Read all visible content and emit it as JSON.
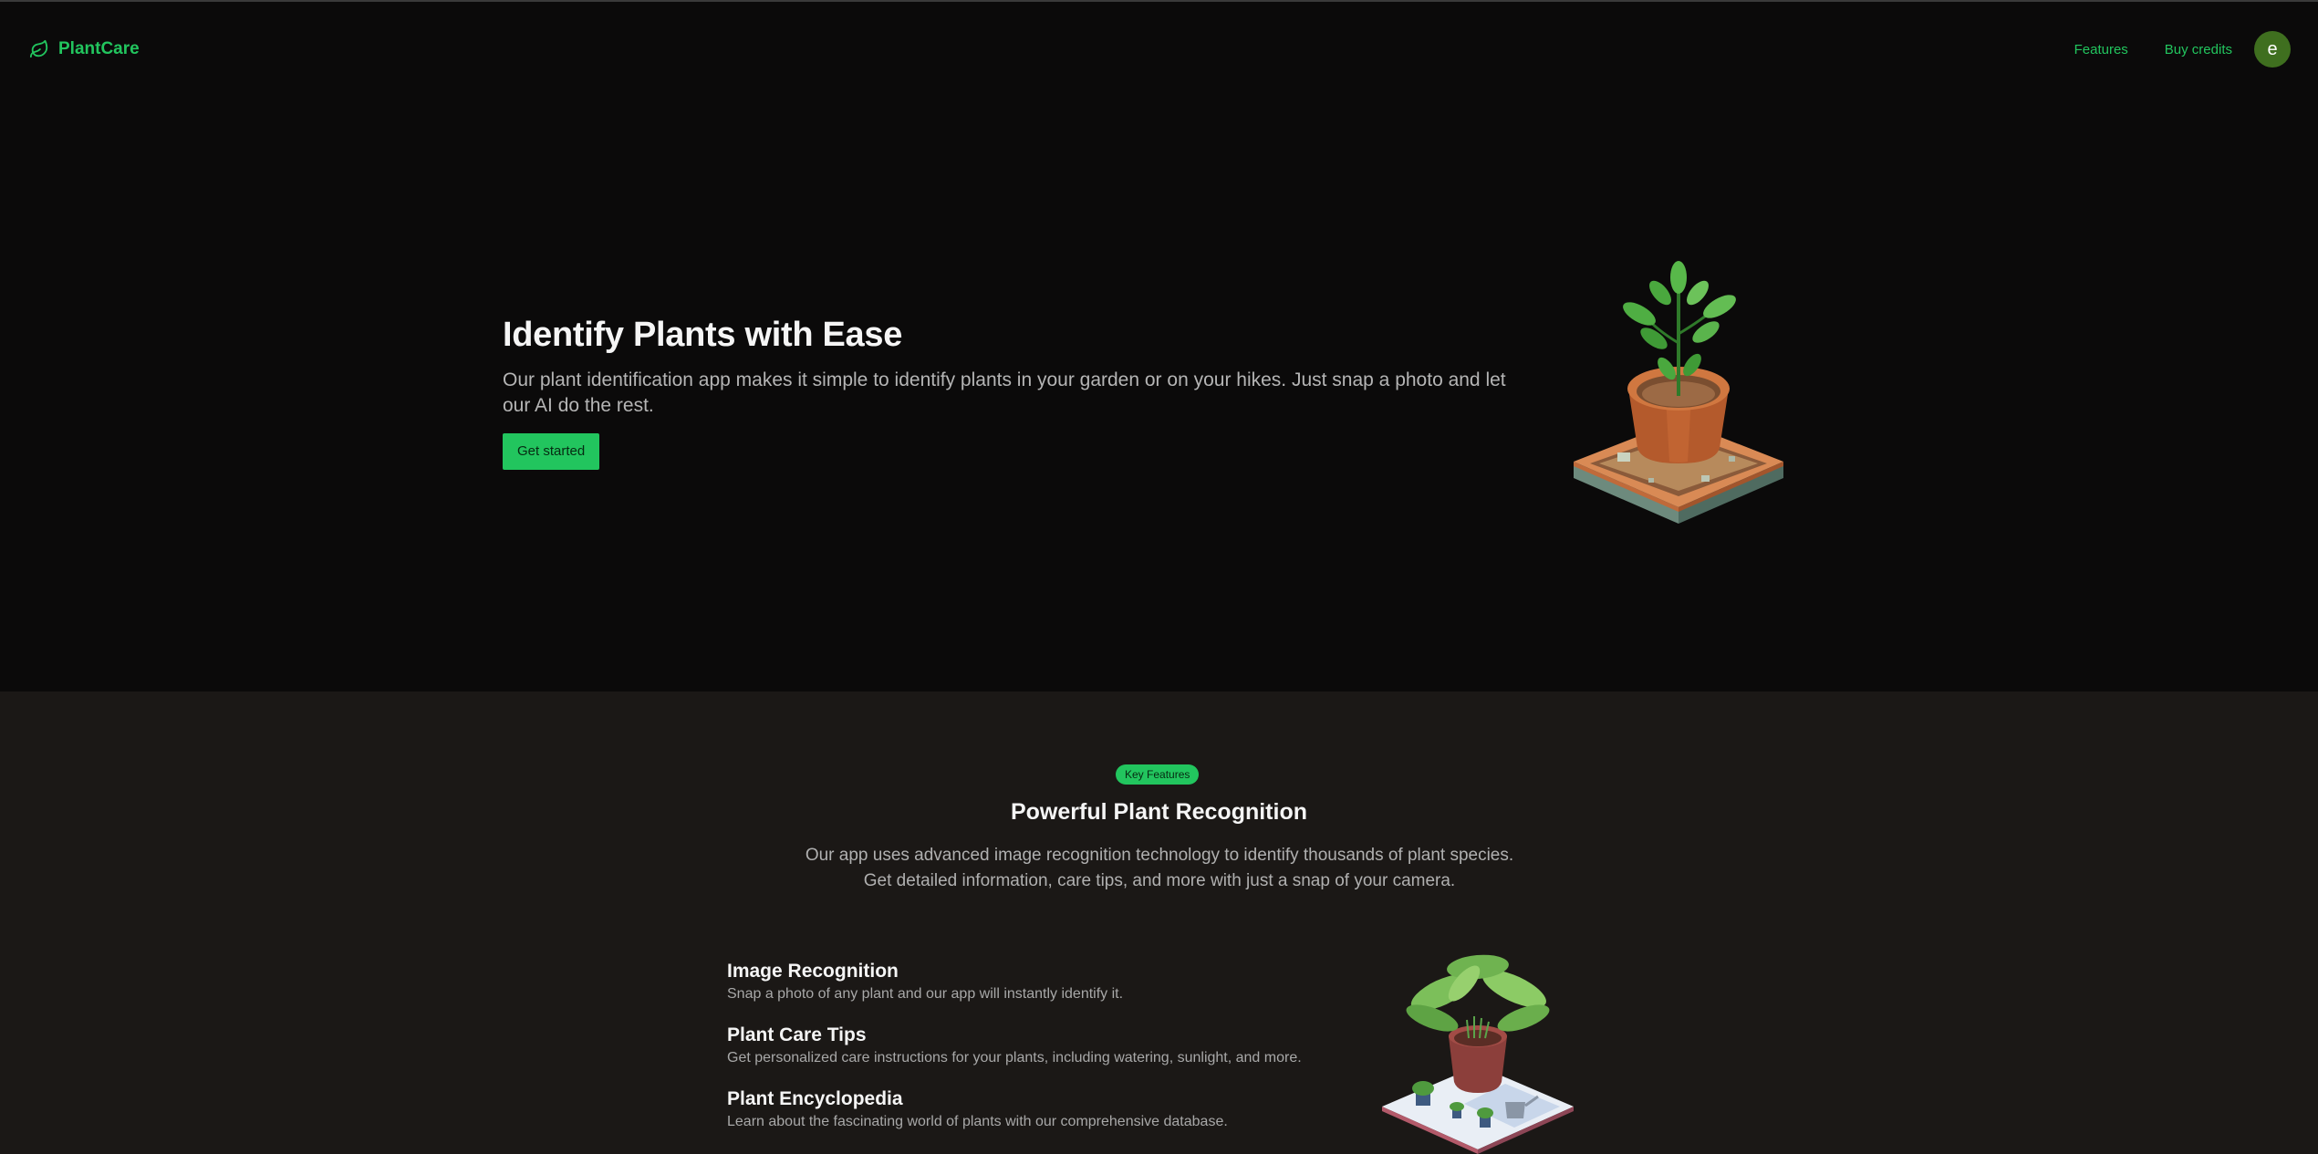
{
  "brand": {
    "name": "PlantCare",
    "icon": "leaf-icon",
    "color": "#22c55e"
  },
  "nav": {
    "features_label": "Features",
    "buy_credits_label": "Buy credits",
    "avatar_initial": "e"
  },
  "hero": {
    "title": "Identify Plants with Ease",
    "description": "Our plant identification app makes it simple to identify plants in your garden or on your hikes. Just snap a photo and let our AI do the rest.",
    "cta_label": "Get started",
    "illustration": "potted-plant-isometric-illustration"
  },
  "features": {
    "badge": "Key Features",
    "title": "Powerful Plant Recognition",
    "description": "Our app uses advanced image recognition technology to identify thousands of plant species. Get detailed information, care tips, and more with just a snap of your camera.",
    "items": [
      {
        "title": "Image Recognition",
        "description": "Snap a photo of any plant and our app will instantly identify it."
      },
      {
        "title": "Plant Care Tips",
        "description": "Get personalized care instructions for your plants, including watering, sunlight, and more."
      },
      {
        "title": "Plant Encyclopedia",
        "description": "Learn about the fascinating world of plants with our comprehensive database."
      }
    ],
    "illustration": "potted-plant-garden-isometric-illustration"
  },
  "colors": {
    "accent": "#22c55e",
    "hero_bg": "#0b0a0a",
    "features_bg": "#1b1816",
    "avatar_bg": "#3f6f1f"
  }
}
